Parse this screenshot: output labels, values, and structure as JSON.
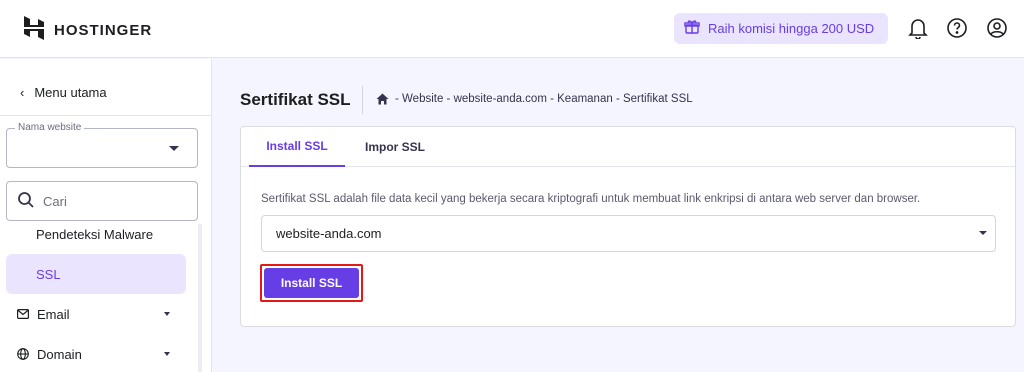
{
  "header": {
    "logo_text": "HOSTINGER",
    "promo_text": "Raih komisi hingga 200 USD",
    "icons": [
      "gift-icon",
      "bell-icon",
      "help-icon",
      "account-icon"
    ]
  },
  "sidebar": {
    "back_label": "Menu utama",
    "website_field": {
      "legend": "Nama website",
      "value": ""
    },
    "search": {
      "placeholder": "Cari"
    },
    "items": [
      {
        "label": "Pendeteksi Malware",
        "active": false
      },
      {
        "label": "SSL",
        "active": true
      },
      {
        "label": "Email",
        "icon": "mail-icon",
        "expandable": true
      },
      {
        "label": "Domain",
        "icon": "globe-icon",
        "expandable": true
      }
    ]
  },
  "page": {
    "title": "Sertifikat SSL",
    "breadcrumb": "- Website - website-anda.com - Keamanan - Sertifikat SSL"
  },
  "card": {
    "tabs": [
      {
        "label": "Install SSL",
        "active": true
      },
      {
        "label": "Impor SSL",
        "active": false
      }
    ],
    "description": "Sertifikat SSL adalah file data kecil yang bekerja secara kriptografi untuk membuat link enkripsi di antara web server dan browser.",
    "domain_select": {
      "value": "website-anda.com"
    },
    "install_button": "Install SSL"
  },
  "colors": {
    "accent": "#673de6",
    "accent_light": "#ebe4ff",
    "highlight_border": "#e61717"
  }
}
